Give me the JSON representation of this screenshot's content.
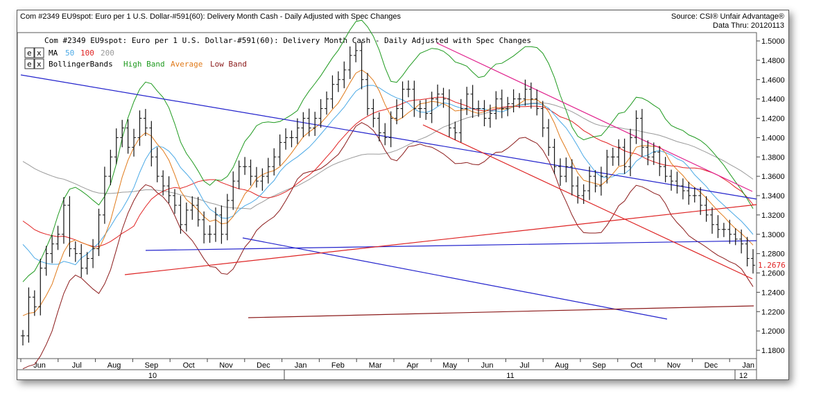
{
  "header": {
    "title": "Com #2349 EU9spot: Euro per 1 U.S. Dollar-#591(60): Delivery Month Cash - Daily Adjusted with Spec Changes",
    "source": "Source: CSI® Unfair Advantage®",
    "data_thru": "Data Thru: 20120113"
  },
  "chart_data": {
    "type": "line",
    "inner_title": "Com #2349 EU9spot: Euro per 1 U.S. Dollar-#591(60): Delivery Month Cash - Daily Adjusted with Spec Changes",
    "legend": {
      "ma_label": "MA",
      "ma_periods": [
        "50",
        "100",
        "200"
      ],
      "bb_label": "BollingerBands",
      "bb_items": [
        "High Band",
        "Average",
        "Low Band"
      ],
      "box_e": "e",
      "box_x": "x"
    },
    "last_price": "1.2676",
    "y_ticks": [
      "1.5000",
      "1.4800",
      "1.4600",
      "1.4400",
      "1.4200",
      "1.4000",
      "1.3800",
      "1.3600",
      "1.3400",
      "1.3200",
      "1.3000",
      "1.2800",
      "1.2600",
      "1.2400",
      "1.2200",
      "1.2000",
      "1.1800"
    ],
    "ylim": [
      1.18,
      1.5
    ],
    "x_months": [
      "Jun",
      "Jul",
      "Aug",
      "Sep",
      "Oct",
      "Nov",
      "Dec",
      "Jan",
      "Feb",
      "Mar",
      "Apr",
      "May",
      "Jun",
      "Jul",
      "Aug",
      "Sep",
      "Oct",
      "Nov",
      "Dec",
      "Jan"
    ],
    "x_years": [
      "10",
      "11",
      "12"
    ],
    "close_points": [
      [
        0,
        1.195
      ],
      [
        1,
        1.235
      ],
      [
        2,
        1.225
      ],
      [
        3,
        1.265
      ],
      [
        4,
        1.28
      ],
      [
        5,
        1.29
      ],
      [
        6,
        1.3
      ],
      [
        7,
        1.33
      ],
      [
        8,
        1.285
      ],
      [
        9,
        1.28
      ],
      [
        10,
        1.265
      ],
      [
        11,
        1.275
      ],
      [
        12,
        1.285
      ],
      [
        13,
        1.32
      ],
      [
        14,
        1.36
      ],
      [
        15,
        1.38
      ],
      [
        16,
        1.4
      ],
      [
        17,
        1.41
      ],
      [
        18,
        1.39
      ],
      [
        19,
        1.4
      ],
      [
        20,
        1.42
      ],
      [
        21,
        1.41
      ],
      [
        22,
        1.38
      ],
      [
        23,
        1.36
      ],
      [
        24,
        1.35
      ],
      [
        25,
        1.34
      ],
      [
        26,
        1.33
      ],
      [
        27,
        1.31
      ],
      [
        28,
        1.325
      ],
      [
        29,
        1.33
      ],
      [
        30,
        1.315
      ],
      [
        31,
        1.3
      ],
      [
        32,
        1.3
      ],
      [
        33,
        1.32
      ],
      [
        34,
        1.3
      ],
      [
        35,
        1.335
      ],
      [
        36,
        1.355
      ],
      [
        37,
        1.37
      ],
      [
        38,
        1.37
      ],
      [
        39,
        1.36
      ],
      [
        40,
        1.355
      ],
      [
        41,
        1.36
      ],
      [
        42,
        1.37
      ],
      [
        43,
        1.38
      ],
      [
        44,
        1.395
      ],
      [
        45,
        1.4
      ],
      [
        46,
        1.4
      ],
      [
        47,
        1.41
      ],
      [
        48,
        1.42
      ],
      [
        49,
        1.41
      ],
      [
        50,
        1.42
      ],
      [
        51,
        1.43
      ],
      [
        52,
        1.44
      ],
      [
        53,
        1.455
      ],
      [
        54,
        1.46
      ],
      [
        55,
        1.47
      ],
      [
        56,
        1.485
      ],
      [
        57,
        1.49
      ],
      [
        58,
        1.46
      ],
      [
        59,
        1.43
      ],
      [
        60,
        1.42
      ],
      [
        61,
        1.405
      ],
      [
        62,
        1.4
      ],
      [
        63,
        1.42
      ],
      [
        64,
        1.43
      ],
      [
        65,
        1.45
      ],
      [
        66,
        1.45
      ],
      [
        67,
        1.43
      ],
      [
        68,
        1.43
      ],
      [
        69,
        1.425
      ],
      [
        70,
        1.44
      ],
      [
        71,
        1.445
      ],
      [
        72,
        1.44
      ],
      [
        73,
        1.41
      ],
      [
        74,
        1.405
      ],
      [
        75,
        1.43
      ],
      [
        76,
        1.445
      ],
      [
        77,
        1.43
      ],
      [
        78,
        1.43
      ],
      [
        79,
        1.42
      ],
      [
        80,
        1.425
      ],
      [
        81,
        1.44
      ],
      [
        82,
        1.43
      ],
      [
        83,
        1.435
      ],
      [
        84,
        1.44
      ],
      [
        85,
        1.44
      ],
      [
        86,
        1.45
      ],
      [
        87,
        1.44
      ],
      [
        88,
        1.43
      ],
      [
        89,
        1.41
      ],
      [
        90,
        1.39
      ],
      [
        91,
        1.37
      ],
      [
        92,
        1.36
      ],
      [
        93,
        1.37
      ],
      [
        94,
        1.35
      ],
      [
        95,
        1.34
      ],
      [
        96,
        1.345
      ],
      [
        97,
        1.36
      ],
      [
        98,
        1.35
      ],
      [
        99,
        1.36
      ],
      [
        100,
        1.38
      ],
      [
        101,
        1.38
      ],
      [
        102,
        1.39
      ],
      [
        103,
        1.37
      ],
      [
        104,
        1.4
      ],
      [
        105,
        1.42
      ],
      [
        106,
        1.39
      ],
      [
        107,
        1.38
      ],
      [
        108,
        1.385
      ],
      [
        109,
        1.37
      ],
      [
        110,
        1.36
      ],
      [
        111,
        1.355
      ],
      [
        112,
        1.35
      ],
      [
        113,
        1.345
      ],
      [
        114,
        1.34
      ],
      [
        115,
        1.34
      ],
      [
        116,
        1.33
      ],
      [
        117,
        1.32
      ],
      [
        118,
        1.31
      ],
      [
        119,
        1.305
      ],
      [
        120,
        1.305
      ],
      [
        121,
        1.3
      ],
      [
        122,
        1.295
      ],
      [
        123,
        1.29
      ],
      [
        124,
        1.275
      ],
      [
        125,
        1.268
      ]
    ]
  }
}
